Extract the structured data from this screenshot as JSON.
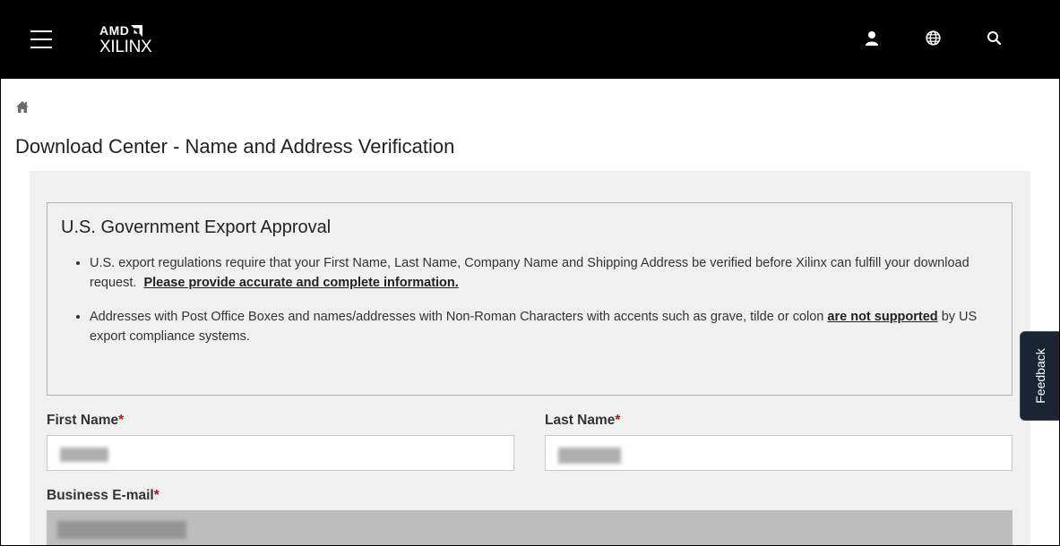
{
  "header": {
    "brand_top": "AMD",
    "brand_bottom": "XILINX",
    "icons": [
      "menu-icon",
      "user-icon",
      "globe-icon",
      "search-icon"
    ]
  },
  "breadcrumb": {
    "home_icon": "home-icon"
  },
  "page": {
    "title": "Download Center - Name and Address Verification"
  },
  "notice": {
    "heading": "U.S. Government Export Approval",
    "bullet1_text": "U.S. export regulations require that your First Name, Last Name, Company Name and Shipping Address be verified before Xilinx can fulfill your download request.",
    "bullet1_link": "Please provide accurate and complete information.",
    "bullet2_text_before": "Addresses with Post Office Boxes and names/addresses with Non-Roman Characters with accents such as grave, tilde or colon",
    "bullet2_link": "are not supported",
    "bullet2_text_after": "by US export compliance systems."
  },
  "form": {
    "first_name_label": "First Name",
    "last_name_label": "Last Name",
    "email_label": "Business E-mail",
    "required_mark": "*"
  },
  "feedback": {
    "label": "Feedback"
  },
  "colors": {
    "header_bg": "#000000",
    "panel_bg": "#f0f0f0",
    "required": "#d0021b",
    "feedback_bg": "#1b2432"
  }
}
